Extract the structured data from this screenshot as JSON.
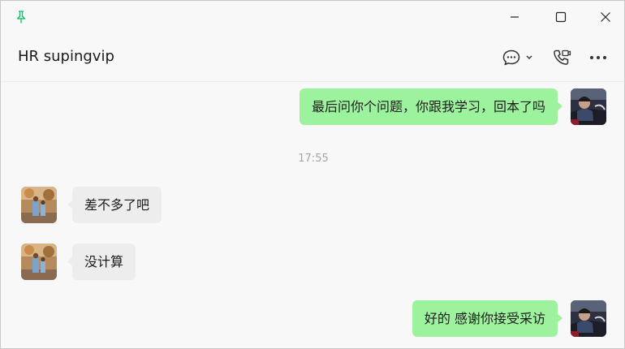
{
  "window": {
    "icons": {
      "pin": "pin-icon",
      "minimize": "minimize-icon",
      "maximize": "maximize-icon",
      "close": "close-icon"
    }
  },
  "header": {
    "title": "HR supingvip",
    "icons": {
      "chat_options": "chat-bubble-icon",
      "call": "phone-call-icon",
      "more": "more-icon"
    }
  },
  "messages": [
    {
      "direction": "out",
      "text": "最后问你个问题，你跟我学习，回本了吗"
    },
    {
      "type": "timestamp",
      "text": "17:55"
    },
    {
      "direction": "in",
      "text": "差不多了吧"
    },
    {
      "direction": "in",
      "text": "没计算"
    },
    {
      "direction": "out",
      "text": "好的 感谢你接受采访"
    }
  ],
  "colors": {
    "background": "#f9f8f9",
    "bubble_out": "#9df39d",
    "bubble_in": "#ededed",
    "pin_accent": "#07c160"
  }
}
